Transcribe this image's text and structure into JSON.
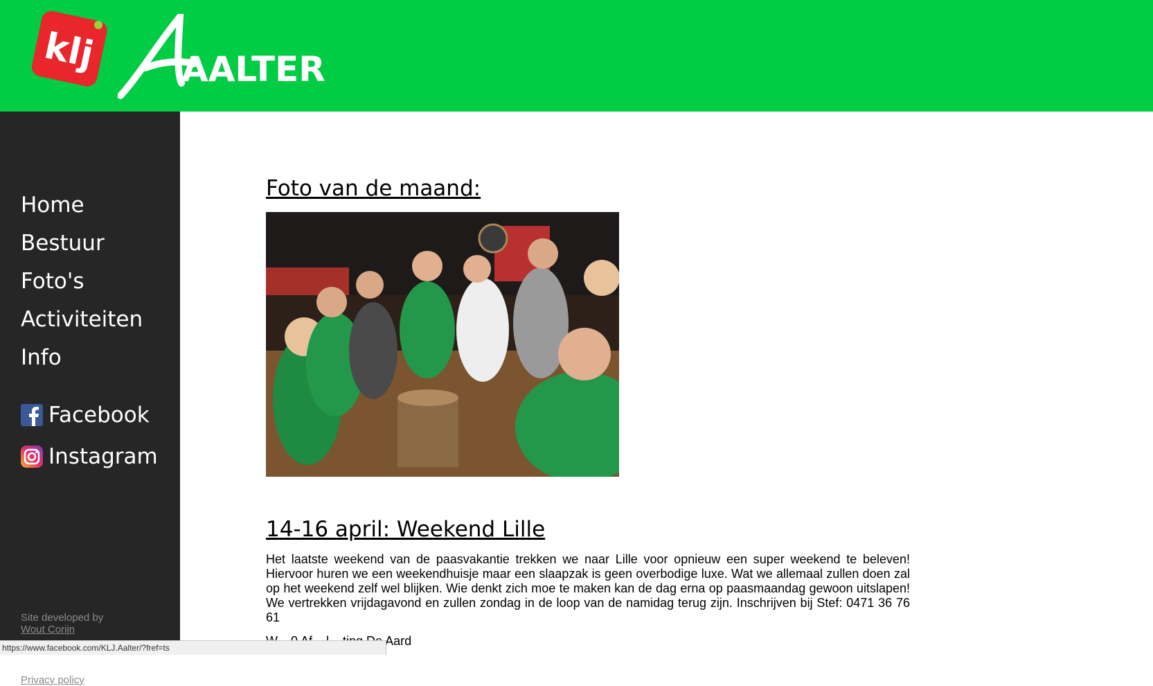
{
  "header": {
    "logo_klj_text": "klj",
    "logo_aalter_text": "AALTER",
    "background_color": "#00cc44"
  },
  "sidebar": {
    "nav_items": [
      "Home",
      "Bestuur",
      "Foto's",
      "Activiteiten",
      "Info"
    ],
    "social": [
      {
        "label": "Facebook",
        "icon": "facebook-icon"
      },
      {
        "label": "Instagram",
        "icon": "instagram-icon"
      }
    ],
    "credit_text": "Site developed by",
    "credit_author": "Wout Corijn",
    "privacy_label": "Privacy policy"
  },
  "main": {
    "photo_heading": "Foto van de maand:",
    "event_heading": "14-16 april: Weekend Lille",
    "event_text": "Het laatste weekend van de paasvakantie trekken we naar Lille voor opnieuw een super weekend te beleven! Hiervoor huren we een weekendhuisje maar een slaapzak is geen overbodige luxe. Wat we allemaal zullen doen zal op het weekend zelf wel blijken. Wie denkt zich moe te maken kan de dag erna op paasmaandag gewoon uitslapen! We vertrekken vrijdagavond en zullen zondag in de loop van de namidag terug zijn. Inschrijven bij Stef: 0471 36 76 61",
    "partial_line": "W... 0 Af... l... ting De Aard"
  },
  "statusbar": {
    "url": "https://www.facebook.com/KLJ.Aalter/?fref=ts"
  }
}
